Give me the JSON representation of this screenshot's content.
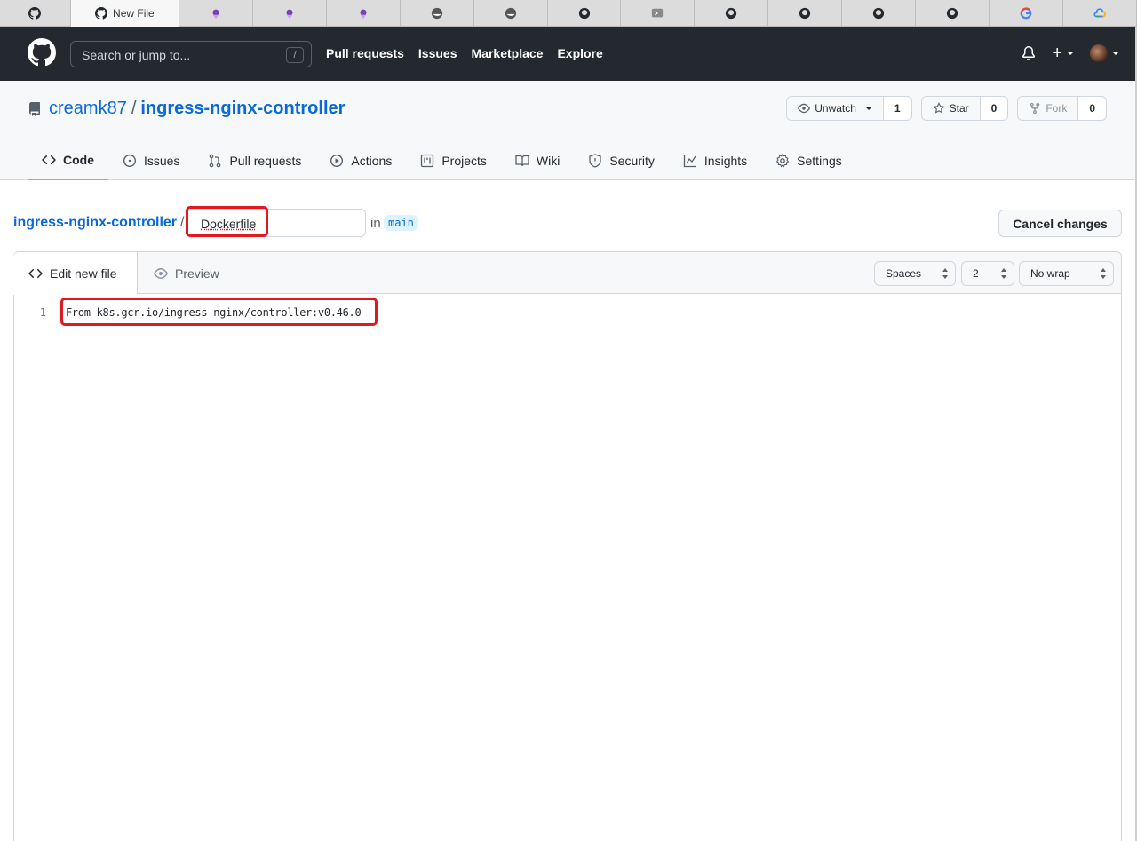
{
  "browser": {
    "active_tab_title": "New File",
    "tab_icons": [
      "github-icon",
      "github-icon",
      "linear-icon",
      "linear-icon",
      "linear-icon",
      "docker-icon",
      "docker-icon",
      "github-icon",
      "terminal-icon",
      "github-icon",
      "github-icon",
      "github-icon",
      "github-icon",
      "google-icon",
      "google-cloud-icon"
    ]
  },
  "header": {
    "search_placeholder": "Search or jump to...",
    "search_shortcut": "/",
    "nav": [
      "Pull requests",
      "Issues",
      "Marketplace",
      "Explore"
    ]
  },
  "repo": {
    "owner": "creamk87",
    "separator": "/",
    "name": "ingress-nginx-controller",
    "watch_label": "Unwatch",
    "watch_count": "1",
    "star_label": "Star",
    "star_count": "0",
    "fork_label": "Fork",
    "fork_count": "0"
  },
  "reponav": {
    "items": [
      {
        "label": "Code",
        "icon": "code-icon",
        "selected": true
      },
      {
        "label": "Issues",
        "icon": "issue-icon"
      },
      {
        "label": "Pull requests",
        "icon": "pull-request-icon"
      },
      {
        "label": "Actions",
        "icon": "play-icon"
      },
      {
        "label": "Projects",
        "icon": "project-icon"
      },
      {
        "label": "Wiki",
        "icon": "book-icon"
      },
      {
        "label": "Security",
        "icon": "shield-icon"
      },
      {
        "label": "Insights",
        "icon": "graph-icon"
      },
      {
        "label": "Settings",
        "icon": "gear-icon"
      }
    ]
  },
  "editor_path": {
    "repo_link": "ingress-nginx-controller",
    "slash": "/",
    "filename_value": "Dockerfile",
    "in_label": "in",
    "branch": "main",
    "cancel_label": "Cancel changes"
  },
  "editor": {
    "tab_edit": "Edit new file",
    "tab_preview": "Preview",
    "indent_mode": "Spaces",
    "indent_size": "2",
    "wrap_mode": "No wrap",
    "lines": [
      {
        "number": "1",
        "code": "From k8s.gcr.io/ingress-nginx/controller:v0.46.0"
      }
    ]
  },
  "colors": {
    "header_bg": "#24292f",
    "link": "#0969da",
    "highlight_box": "#e0191f",
    "selected_tab_underline": "#fd8c73"
  }
}
